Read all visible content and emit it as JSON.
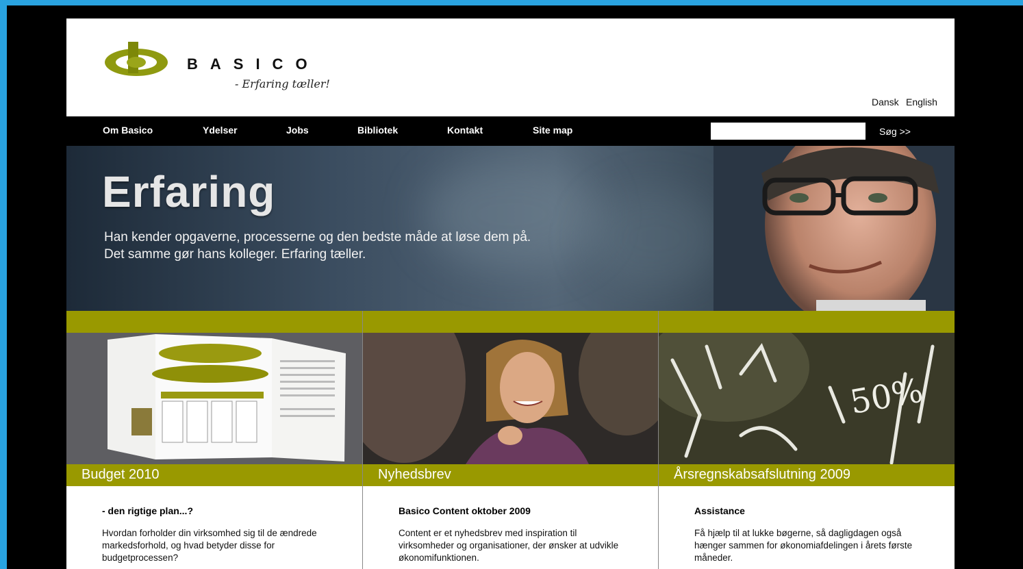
{
  "brand": {
    "name": "BASICO",
    "tagline": "- Erfaring tæller!"
  },
  "languages": [
    "Dansk",
    "English"
  ],
  "nav": {
    "items": [
      "Om Basico",
      "Ydelser",
      "Jobs",
      "Bibliotek",
      "Kontakt",
      "Site map"
    ],
    "search_value": "",
    "search_button": "Søg >>"
  },
  "hero": {
    "title": "Erfaring",
    "line1": "Han kender opgaverne, processerne og den bedste måde at løse dem på.",
    "line2": "Det samme gør hans kolleger. Erfaring tæller."
  },
  "columns": [
    {
      "title": "Budget 2010",
      "heading": "- den rigtige plan...?",
      "text": "Hvordan forholder din virksomhed sig til de ændrede markedsforhold, og hvad betyder disse for budgetprocessen?"
    },
    {
      "title": "Nyhedsbrev",
      "heading": "Basico Content oktober 2009",
      "text": "Content er et nyhedsbrev med inspiration til virksomheder og organisationer, der ønsker at udvikle økonomifunktionen."
    },
    {
      "title": "Årsregnskabsafslutning 2009",
      "heading": "Assistance",
      "text": "Få hjælp til at lukke bøgerne, så dagligdagen også hænger sammen for økonomiafdelingen i årets første måneder."
    }
  ],
  "colors": {
    "accent": "#999900",
    "frame": "#29a3e0",
    "nav": "#000000"
  }
}
